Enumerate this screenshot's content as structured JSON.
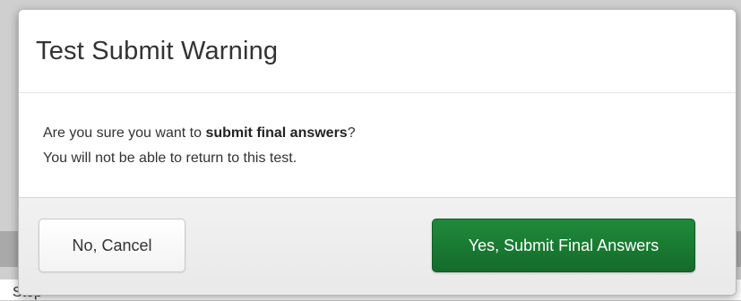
{
  "dialog": {
    "title": "Test Submit Warning",
    "message": {
      "line1_prefix": "Are you sure you want to ",
      "line1_bold": "submit final answers",
      "line1_suffix": "?",
      "line2": "You will not be able to return to this test."
    },
    "buttons": {
      "cancel_label": "No, Cancel",
      "submit_label": "Yes, Submit Final Answers"
    }
  },
  "background": {
    "partial_text": "Stop"
  },
  "colors": {
    "submit_button": "#1a7a33",
    "cancel_button": "#f7f7f7",
    "title_text": "#333333"
  }
}
